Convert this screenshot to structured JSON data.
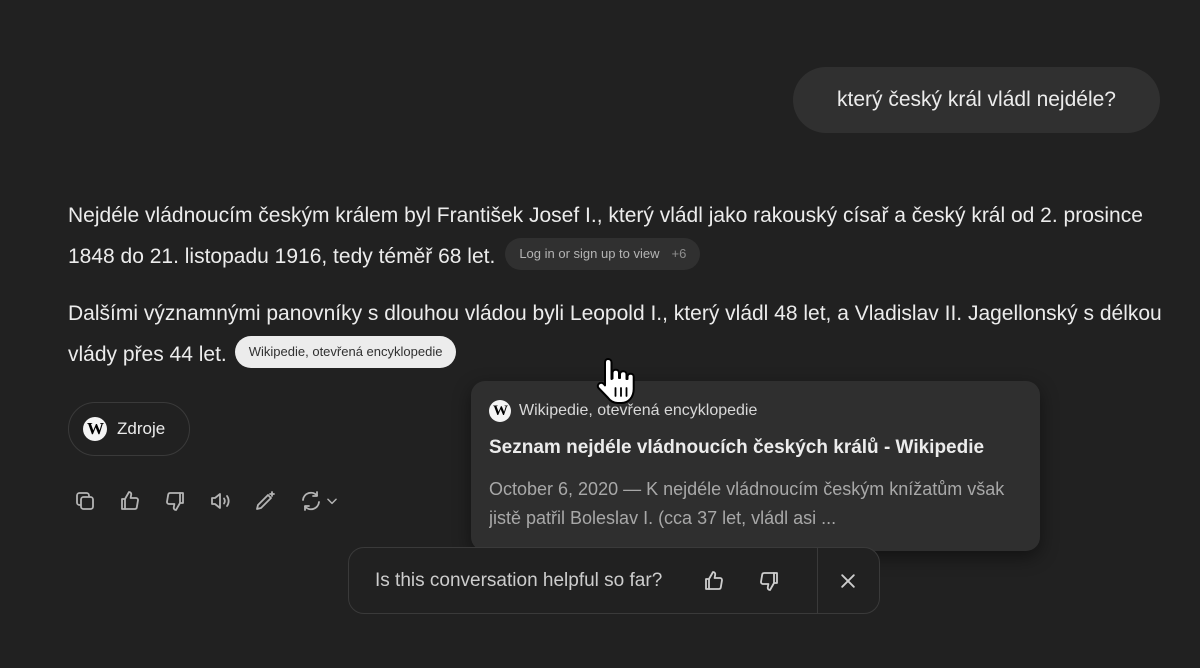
{
  "user_message": "který český král vládl nejdéle?",
  "answer": {
    "paragraph1": "Nejdéle vládnoucím českým králem byl František Josef I., který vládl jako rakouský císař a český král od 2. prosince 1848 do 21. listopadu 1916, tedy téměř 68 let.",
    "citation1_label": "Log in or sign up to view",
    "citation1_count": "+6",
    "paragraph2": "Dalšími významnými panovníky s dlouhou vládou byli Leopold I., který vládl 48 let, a Vladislav II. Jagellonský s délkou vlády přes 44 let.",
    "citation2_label": "Wikipedie, otevřená encyklopedie"
  },
  "sources_button": {
    "label": "Zdroje",
    "logo_text": "W"
  },
  "popover": {
    "source": "Wikipedie, otevřená encyklopedie",
    "logo_text": "W",
    "title": "Seznam nejdéle vládnoucích českých králů - Wikipedie",
    "snippet": "October 6, 2020 — K nejdéle vládnoucím českým knížatům však jistě patřil Boleslav I. (cca 37 let, vládl asi ..."
  },
  "message_actions": [
    "copy-icon",
    "thumbs-up-icon",
    "thumbs-down-icon",
    "read-aloud-icon",
    "edit-icon",
    "regenerate-icon"
  ],
  "feedback": {
    "question": "Is this conversation helpful so far?"
  },
  "colors": {
    "background": "#212121",
    "bubble": "#303030",
    "popover": "#2f2f2f",
    "text": "#ececec",
    "muted": "#a8a8a8"
  }
}
